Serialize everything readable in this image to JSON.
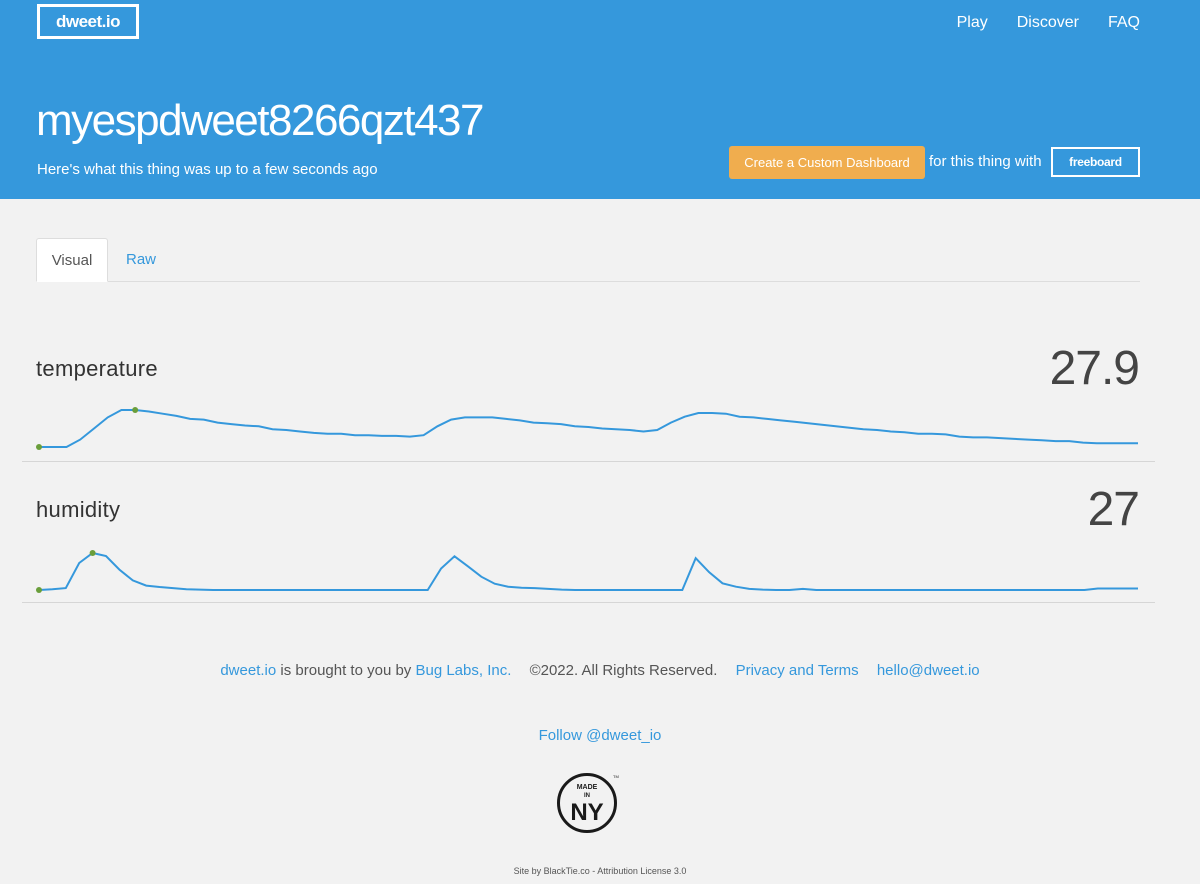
{
  "header": {
    "logo": "dweet.io",
    "nav": [
      "Play",
      "Discover",
      "FAQ"
    ],
    "thing_name": "myespdweet8266qzt437",
    "subtitle": "Here's what this thing was up to a few seconds ago",
    "dashboard_button": "Create a Custom Dashboard",
    "for_text": "for this thing with",
    "freeboard": "freeboard"
  },
  "tabs": [
    "Visual",
    "Raw"
  ],
  "metrics": [
    {
      "label": "temperature",
      "value": "27.9",
      "line_color": "#3598dc",
      "marker_color": "#6a9e3b",
      "sparkline": [
        26.8,
        26.8,
        26.8,
        26.9,
        27.05,
        27.2,
        27.3,
        27.3,
        27.28,
        27.25,
        27.22,
        27.18,
        27.17,
        27.13,
        27.11,
        27.09,
        27.08,
        27.04,
        27.03,
        27.01,
        26.99,
        26.98,
        26.98,
        26.96,
        26.96,
        26.95,
        26.95,
        26.94,
        26.96,
        27.08,
        27.17,
        27.2,
        27.2,
        27.2,
        27.18,
        27.16,
        27.13,
        27.12,
        27.11,
        27.08,
        27.07,
        27.05,
        27.04,
        27.03,
        27.01,
        27.03,
        27.13,
        27.21,
        27.26,
        27.26,
        27.25,
        27.21,
        27.2,
        27.18,
        27.16,
        27.14,
        27.12,
        27.1,
        27.08,
        27.06,
        27.04,
        27.03,
        27.01,
        27.0,
        26.98,
        26.98,
        26.97,
        26.94,
        26.93,
        26.93,
        26.92,
        26.91,
        26.9,
        26.89,
        26.88,
        26.88,
        26.86,
        26.85,
        26.85,
        26.85,
        26.85
      ],
      "markers": [
        0,
        7
      ]
    },
    {
      "label": "humidity",
      "value": "27",
      "line_color": "#3598dc",
      "marker_color": "#6a9e3b",
      "sparkline": [
        0.0,
        0.02,
        0.05,
        0.73,
        1.0,
        0.92,
        0.55,
        0.26,
        0.12,
        0.08,
        0.05,
        0.02,
        0.01,
        0.0,
        0.0,
        0.0,
        0.0,
        0.0,
        0.0,
        0.0,
        0.0,
        0.0,
        0.0,
        0.0,
        0.0,
        0.0,
        0.0,
        0.0,
        0.0,
        0.0,
        0.58,
        0.91,
        0.64,
        0.36,
        0.17,
        0.09,
        0.06,
        0.05,
        0.03,
        0.01,
        0.0,
        0.0,
        0.0,
        0.0,
        0.0,
        0.0,
        0.0,
        0.0,
        0.0,
        0.86,
        0.48,
        0.18,
        0.09,
        0.03,
        0.01,
        0.0,
        0.0,
        0.03,
        0.0,
        0.0,
        0.0,
        0.0,
        0.0,
        0.0,
        0.0,
        0.0,
        0.0,
        0.0,
        0.0,
        0.0,
        0.0,
        0.0,
        0.0,
        0.0,
        0.0,
        0.0,
        0.0,
        0.0,
        0.0,
        0.04,
        0.04,
        0.04,
        0.04
      ],
      "markers": [
        0,
        4
      ]
    }
  ],
  "footer": {
    "brand_link": "dweet.io",
    "brought_by": "is brought to you by",
    "company_link": "Bug Labs, Inc.",
    "copyright": "©2022. All Rights Reserved.",
    "privacy_link": "Privacy and Terms",
    "email_link": "hello@dweet.io",
    "follow": "Follow @dweet_io",
    "made_in_top": "MADE",
    "made_in_mid": "IN",
    "made_in_bottom": "NY",
    "credit": "Site by BlackTie.co - Attribution License 3.0"
  }
}
